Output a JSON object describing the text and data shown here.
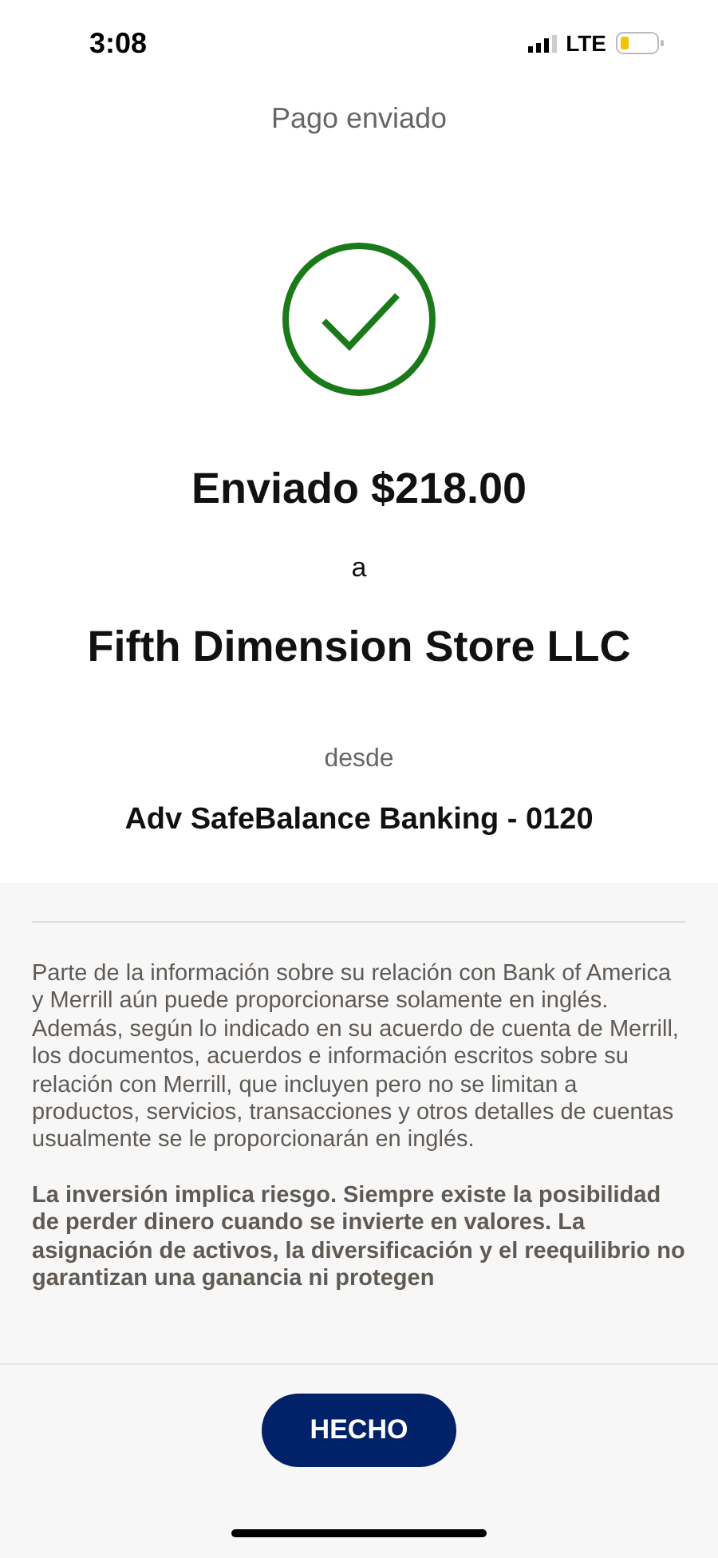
{
  "status_bar": {
    "time": "3:08",
    "network": "LTE"
  },
  "title": "Pago enviado",
  "confirmation": {
    "amount_line": "Enviado $218.00",
    "connector": "a",
    "recipient": "Fifth Dimension Store LLC",
    "from_label": "desde",
    "account": "Adv SafeBalance Banking - 0120"
  },
  "disclosures": [
    {
      "kind": "normal",
      "text": "Parte de la información sobre su relación con Bank of America y Merrill aún puede proporcionarse solamente en inglés. Además, según lo indicado en su acuerdo de cuenta de Merrill, los documentos, acuerdos e información escritos sobre su relación con Merrill, que incluyen pero no se limitan a productos, servicios, transacciones y otros detalles de cuentas usualmente se le proporcionarán en inglés."
    },
    {
      "kind": "bold",
      "text": "La inversión implica riesgo. Siempre existe la posibilidad de perder dinero cuando se invierte en valores. La asignación de activos, la diversificación y el reequilibrio no garantizan una ganancia ni protegen"
    }
  ],
  "done_button": "HECHO"
}
